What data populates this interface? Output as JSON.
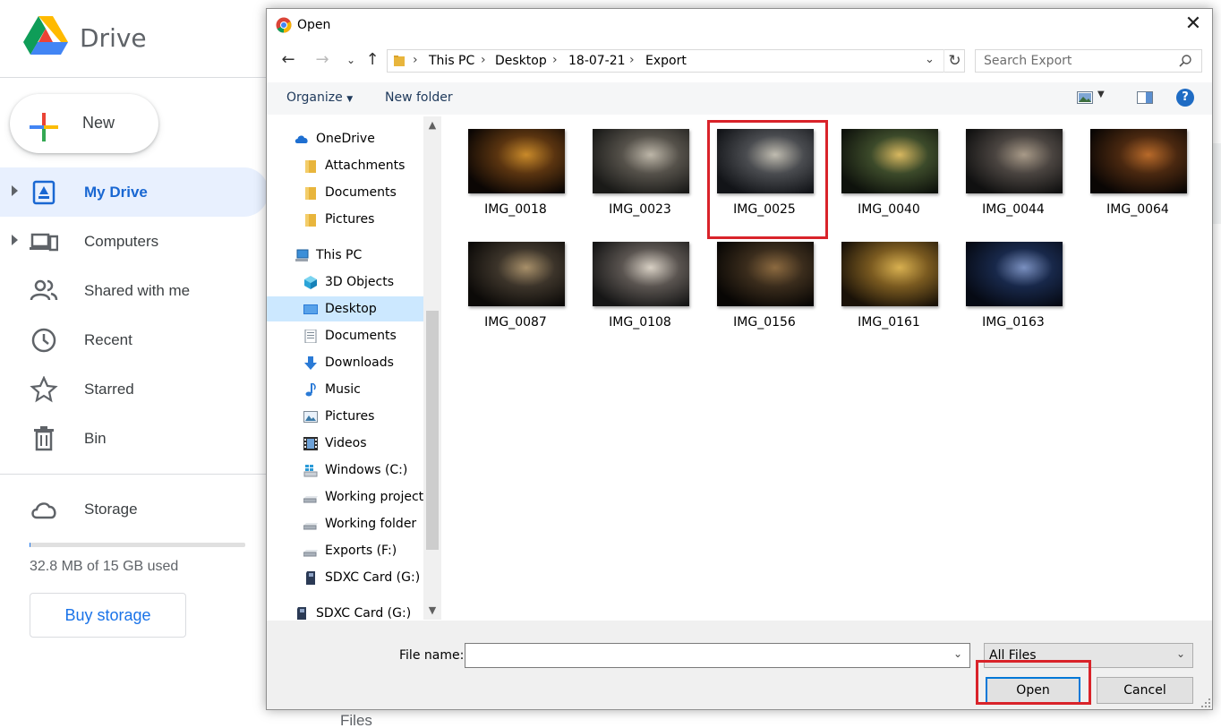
{
  "drive": {
    "app_title": "Drive",
    "new_button": "New",
    "nav": [
      {
        "label": "My Drive",
        "icon": "my-drive-icon",
        "active": true
      },
      {
        "label": "Computers",
        "icon": "computers-icon"
      },
      {
        "label": "Shared with me",
        "icon": "shared-icon"
      },
      {
        "label": "Recent",
        "icon": "clock-icon"
      },
      {
        "label": "Starred",
        "icon": "star-icon"
      },
      {
        "label": "Bin",
        "icon": "trash-icon"
      }
    ],
    "storage": {
      "label": "Storage",
      "used_text": "32.8 MB of 15 GB used",
      "used_fraction": 0.002,
      "buy_button": "Buy storage"
    },
    "files_label": "Files",
    "accent_color": "#1a73e8"
  },
  "dialog": {
    "title": "Open",
    "breadcrumb": [
      "This PC",
      "Desktop",
      "18-07-21",
      "Export"
    ],
    "search_placeholder": "Search Export",
    "toolbar": {
      "organize": "Organize",
      "new_folder": "New folder",
      "help": "?"
    },
    "tree": [
      {
        "label": "OneDrive",
        "icon": "onedrive-icon",
        "level": 0
      },
      {
        "label": "Attachments",
        "icon": "folder-icon",
        "level": 1
      },
      {
        "label": "Documents",
        "icon": "folder-icon",
        "level": 1
      },
      {
        "label": "Pictures",
        "icon": "folder-icon",
        "level": 1
      },
      {
        "label": "This PC",
        "icon": "pc-icon",
        "level": 0
      },
      {
        "label": "3D Objects",
        "icon": "3d-objects-icon",
        "level": 1
      },
      {
        "label": "Desktop",
        "icon": "desktop-icon",
        "level": 1,
        "selected": true
      },
      {
        "label": "Documents",
        "icon": "documents-icon",
        "level": 1
      },
      {
        "label": "Downloads",
        "icon": "downloads-icon",
        "level": 1
      },
      {
        "label": "Music",
        "icon": "music-icon",
        "level": 1
      },
      {
        "label": "Pictures",
        "icon": "pictures-icon",
        "level": 1
      },
      {
        "label": "Videos",
        "icon": "videos-icon",
        "level": 1
      },
      {
        "label": "Windows (C:)",
        "icon": "windows-drive-icon",
        "level": 1
      },
      {
        "label": "Working projects",
        "icon": "drive-icon",
        "level": 1
      },
      {
        "label": "Working folder",
        "icon": "drive-icon",
        "level": 1
      },
      {
        "label": "Exports (F:)",
        "icon": "drive-icon",
        "level": 1
      },
      {
        "label": "SDXC Card (G:)",
        "icon": "sd-card-icon",
        "level": 1
      },
      {
        "label": "SDXC Card (G:)",
        "icon": "sd-card-icon",
        "level": 0
      }
    ],
    "files": [
      {
        "name": "IMG_0018",
        "colors": [
          "#0b0604",
          "#5a3410",
          "#c98a2a"
        ]
      },
      {
        "name": "IMG_0023",
        "colors": [
          "#1a1a18",
          "#55514a",
          "#bdb6a8"
        ]
      },
      {
        "name": "IMG_0025",
        "colors": [
          "#121418",
          "#4a4c50",
          "#c0bcb0"
        ],
        "highlighted": true
      },
      {
        "name": "IMG_0040",
        "colors": [
          "#0e120c",
          "#3c4a2a",
          "#d8b860"
        ]
      },
      {
        "name": "IMG_0044",
        "colors": [
          "#101010",
          "#4a4440",
          "#a89a88"
        ]
      },
      {
        "name": "IMG_0064",
        "colors": [
          "#0a0604",
          "#4a2810",
          "#b86a2a"
        ]
      },
      {
        "name": "IMG_0087",
        "colors": [
          "#0c0a08",
          "#3c342a",
          "#a8906a"
        ]
      },
      {
        "name": "IMG_0108",
        "colors": [
          "#161616",
          "#5a5450",
          "#d8d0c4"
        ]
      },
      {
        "name": "IMG_0156",
        "colors": [
          "#080604",
          "#3a2c1c",
          "#8c6a40"
        ]
      },
      {
        "name": "IMG_0161",
        "colors": [
          "#1a1208",
          "#7a5a20",
          "#d8b050"
        ]
      },
      {
        "name": "IMG_0163",
        "colors": [
          "#060a14",
          "#18284a",
          "#7a90c0"
        ]
      }
    ],
    "file_name_label": "File name:",
    "file_name_value": "",
    "filter": "All Files",
    "open_button": "Open",
    "cancel_button": "Cancel",
    "highlight_color": "#d9232a"
  }
}
